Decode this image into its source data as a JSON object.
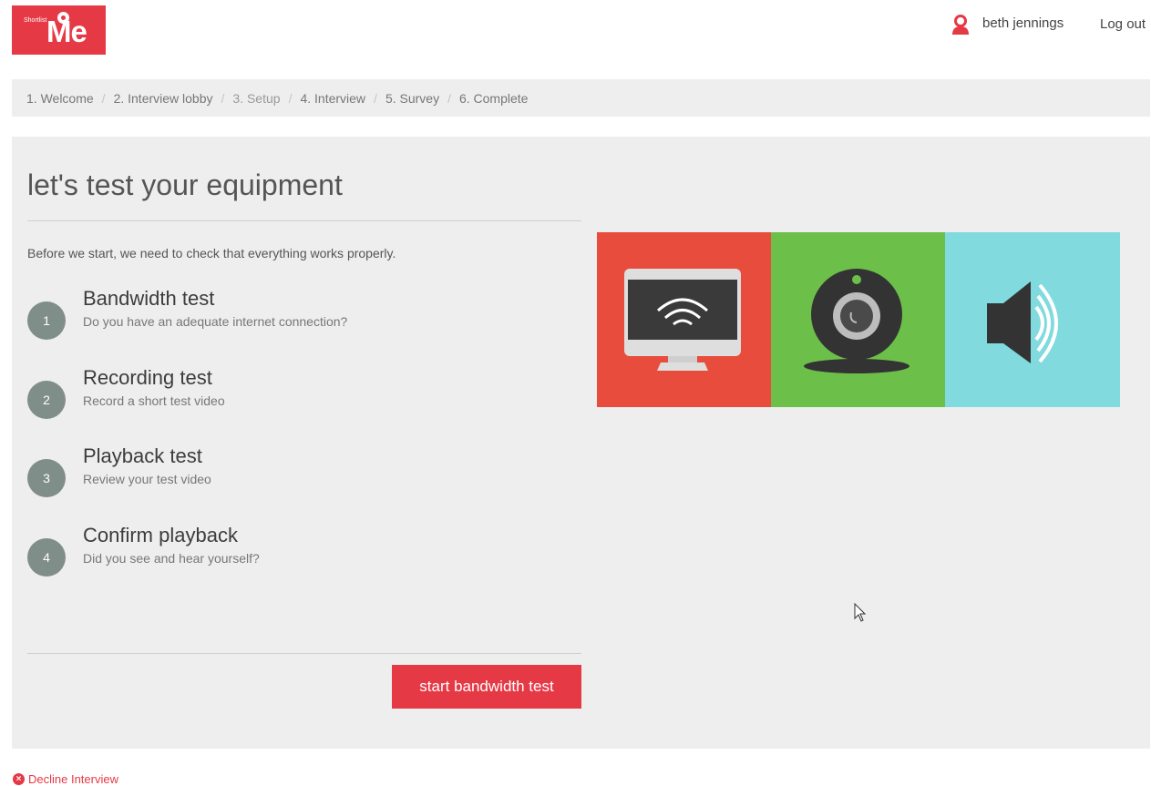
{
  "brand": {
    "small_text": "Shortlist",
    "big_text": "Me",
    "color": "#e63946"
  },
  "header": {
    "user_name": "beth jennings",
    "logout_label": "Log out"
  },
  "breadcrumb": {
    "items": [
      {
        "label": "1. Welcome"
      },
      {
        "label": "2. Interview lobby"
      },
      {
        "label": "3. Setup"
      },
      {
        "label": "4. Interview"
      },
      {
        "label": "5. Survey"
      },
      {
        "label": "6. Complete"
      }
    ],
    "separator": "/"
  },
  "main": {
    "heading": "let's test your equipment",
    "intro": "Before we start, we need to check that everything works properly.",
    "steps": [
      {
        "number": "1",
        "title": "Bandwidth test",
        "description": "Do you have an adequate internet connection?"
      },
      {
        "number": "2",
        "title": "Recording test",
        "description": "Record a short test video"
      },
      {
        "number": "3",
        "title": "Playback test",
        "description": "Review your test video"
      },
      {
        "number": "4",
        "title": "Confirm playback",
        "description": "Did you see and hear yourself?"
      }
    ],
    "start_button_label": "start bandwidth test"
  },
  "illustration": {
    "tiles": [
      {
        "icon": "monitor-wifi-icon",
        "color": "#e84c3d"
      },
      {
        "icon": "webcam-icon",
        "color": "#6cc04a"
      },
      {
        "icon": "speaker-icon",
        "color": "#81dade"
      }
    ]
  },
  "footer": {
    "decline_label": "Decline Interview"
  }
}
